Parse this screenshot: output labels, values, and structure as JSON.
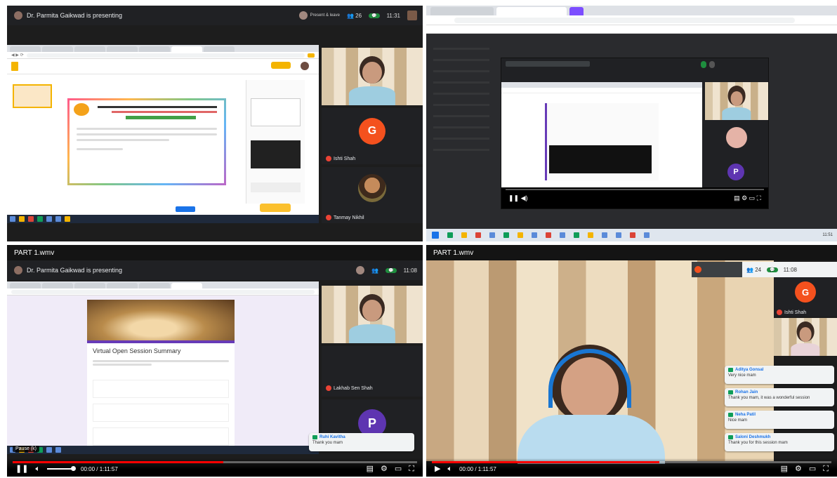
{
  "panel1": {
    "presenter_text": "Dr. Parmita Gaikwad is presenting",
    "you_label": "Present & leave",
    "time": "11:31",
    "participant_count": "26",
    "participants": [
      {
        "initial": "G",
        "name": "Ishti Shah",
        "color": "#f4511e"
      },
      {
        "initial": "",
        "name": "Tanmay Nikhil"
      }
    ]
  },
  "panel2": {
    "taskbar_time": "11:51"
  },
  "panel3": {
    "video_title": "PART 1.wmv",
    "presenter_text": "Dr. Parmita Gaikwad is presenting",
    "time": "11:08",
    "form_title": "Virtual Open Session Summary",
    "participants": [
      {
        "name": "Lakhab Sen Shah"
      },
      {
        "initial": "P",
        "name": "",
        "color": "#5e35b1"
      }
    ],
    "toast_name": "Ruhi Kavitha",
    "toast_text": "Thank you mam",
    "player_label": "Pause (k)",
    "timestamp": "00:00 / 1:11:57"
  },
  "panel4": {
    "video_title": "PART 1.wmv",
    "time": "11:08",
    "participant_count": "24",
    "tile_initial": "G",
    "tile_name": "Ishti Shah",
    "timestamp": "00:00 / 1:11:57",
    "chats": [
      {
        "name": "Aditya Gonsal",
        "text": "Very nice mam"
      },
      {
        "name": "Rohan Jain",
        "text": "Thank you mam, it was a wonderful session"
      },
      {
        "name": "Neha Patil",
        "text": "Nice mam"
      },
      {
        "name": "Saloni Deshmukh",
        "text": "Thank you for this session mam"
      }
    ]
  },
  "colors": {
    "youtube_red": "#ff0000",
    "meet_dark": "#202124",
    "accent_blue": "#1a73e8"
  }
}
